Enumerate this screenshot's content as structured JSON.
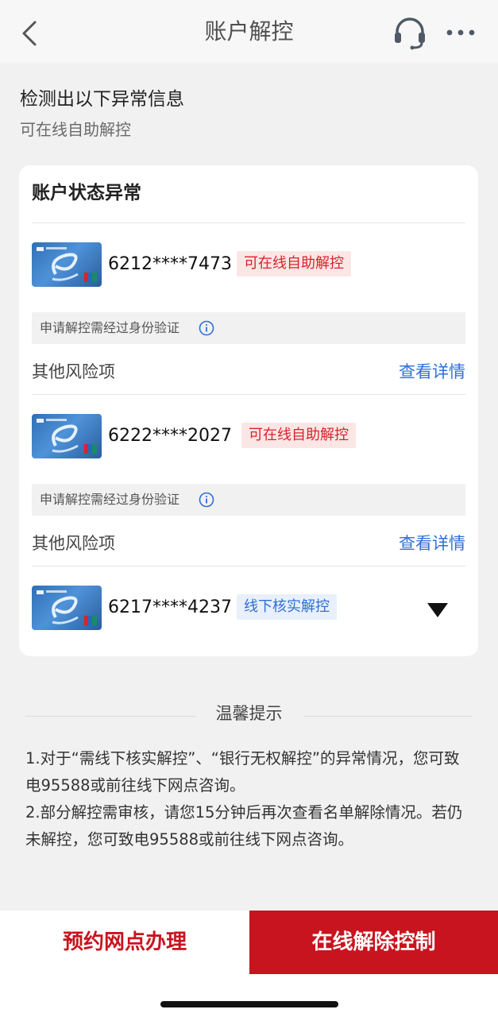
{
  "header": {
    "title": "账户解控",
    "back_icon": "chevron-left-icon",
    "service_icon": "headset-icon",
    "more_icon": "more-dots-icon"
  },
  "notice": {
    "title": "检测出以下异常信息",
    "subtitle": "可在线自助解控"
  },
  "card": {
    "title": "账户状态异常",
    "accounts": [
      {
        "number": "6212****7473",
        "tag": "可在线自助解控",
        "tag_type": "red",
        "verify_text": "申请解控需经过身份验证",
        "risk_label": "其他风险项",
        "detail_link": "查看详情"
      },
      {
        "number": "6222****2027",
        "tag": "可在线自助解控",
        "tag_type": "red",
        "verify_text": "申请解控需经过身份验证",
        "risk_label": "其他风险项",
        "detail_link": "查看详情"
      },
      {
        "number": "6217****4237",
        "tag": "线下核实解控",
        "tag_type": "blue"
      }
    ]
  },
  "tips": {
    "title": "温馨提示",
    "lines": [
      "1.对于“需线下核实解控”、“银行无权解控”的异常情况，您可致电95588或前往线下网点咨询。",
      "2.部分解控需审核，请您15分钟后再次查看名单解除情况。若仍未解控，您可致电95588或前往线下网点咨询。"
    ]
  },
  "buttons": {
    "appointment": "预约网点办理",
    "online_release": "在线解除控制"
  },
  "colors": {
    "brand_red": "#c8141e",
    "link_blue": "#2f6fd6",
    "tag_red_bg": "#fbe6e6",
    "tag_blue_bg": "#e8f0fb"
  }
}
